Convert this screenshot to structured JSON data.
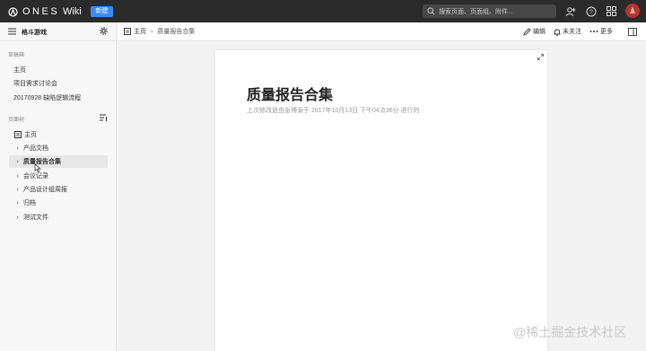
{
  "topbar": {
    "brand": "ONES",
    "product": "Wiki",
    "new_button": "新建",
    "search_placeholder": "搜索页面、页面组、附件...",
    "icons": [
      "add-member-icon",
      "help-icon",
      "apps-grid-icon"
    ]
  },
  "sidebar": {
    "title": "格斗游戏",
    "drafts_label": "草稿箱",
    "drafts": [
      "主页",
      "项目需求讨论会",
      "20170928 缺陷逻辑流程"
    ],
    "tree_label": "页面树",
    "home": "主页",
    "tree": [
      {
        "label": "产品文档",
        "selected": false
      },
      {
        "label": "质量报告合集",
        "selected": true
      },
      {
        "label": "会议记录",
        "selected": false
      },
      {
        "label": "产品设计组周报",
        "selected": false
      },
      {
        "label": "归档",
        "selected": false
      },
      {
        "label": "测试文件",
        "selected": false
      }
    ]
  },
  "breadcrumb": {
    "home": "主页",
    "current": "质量报告合集"
  },
  "actions": {
    "edit": "编辑",
    "follow": "未关注",
    "more": "更多"
  },
  "page": {
    "title": "质量报告合集",
    "meta": "上次修改是由张博源于 2017年10月13日 下午04点36分 进行的"
  },
  "watermark": "@稀土掘金技术社区",
  "colors": {
    "topbar": "#2b2b2b",
    "accent": "#3a8cf5",
    "avatar": "#b5352e"
  }
}
